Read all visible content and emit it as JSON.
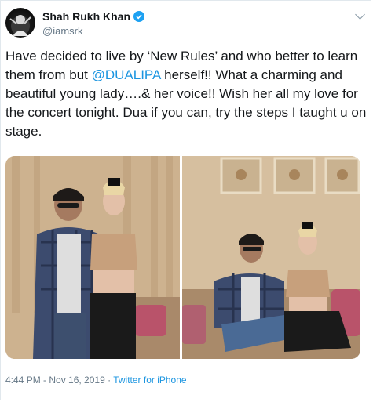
{
  "author": {
    "name": "Shah Rukh Khan",
    "handle": "@iamsrk",
    "avatar_icon": "avatar-icon",
    "verified_icon": "verified-badge-icon"
  },
  "menu_icon": "chevron-down-icon",
  "tweet": {
    "text_part1": "Have decided to live by ‘New Rules’ and who better to learn them from but ",
    "mention": "@DUALIPA",
    "text_part2": " herself!! What a charming and beautiful young lady….& her voice!! Wish her all my love for the concert tonight. Dua if you can, try the steps I taught u on stage."
  },
  "media": {
    "photos": [
      "photo-1",
      "photo-2"
    ]
  },
  "footer": {
    "timestamp": "4:44 PM - Nov 16, 2019",
    "separator": " · ",
    "source": "Twitter for iPhone"
  },
  "colors": {
    "link": "#1b95e0",
    "verified": "#1da1f2",
    "meta": "#657786"
  }
}
